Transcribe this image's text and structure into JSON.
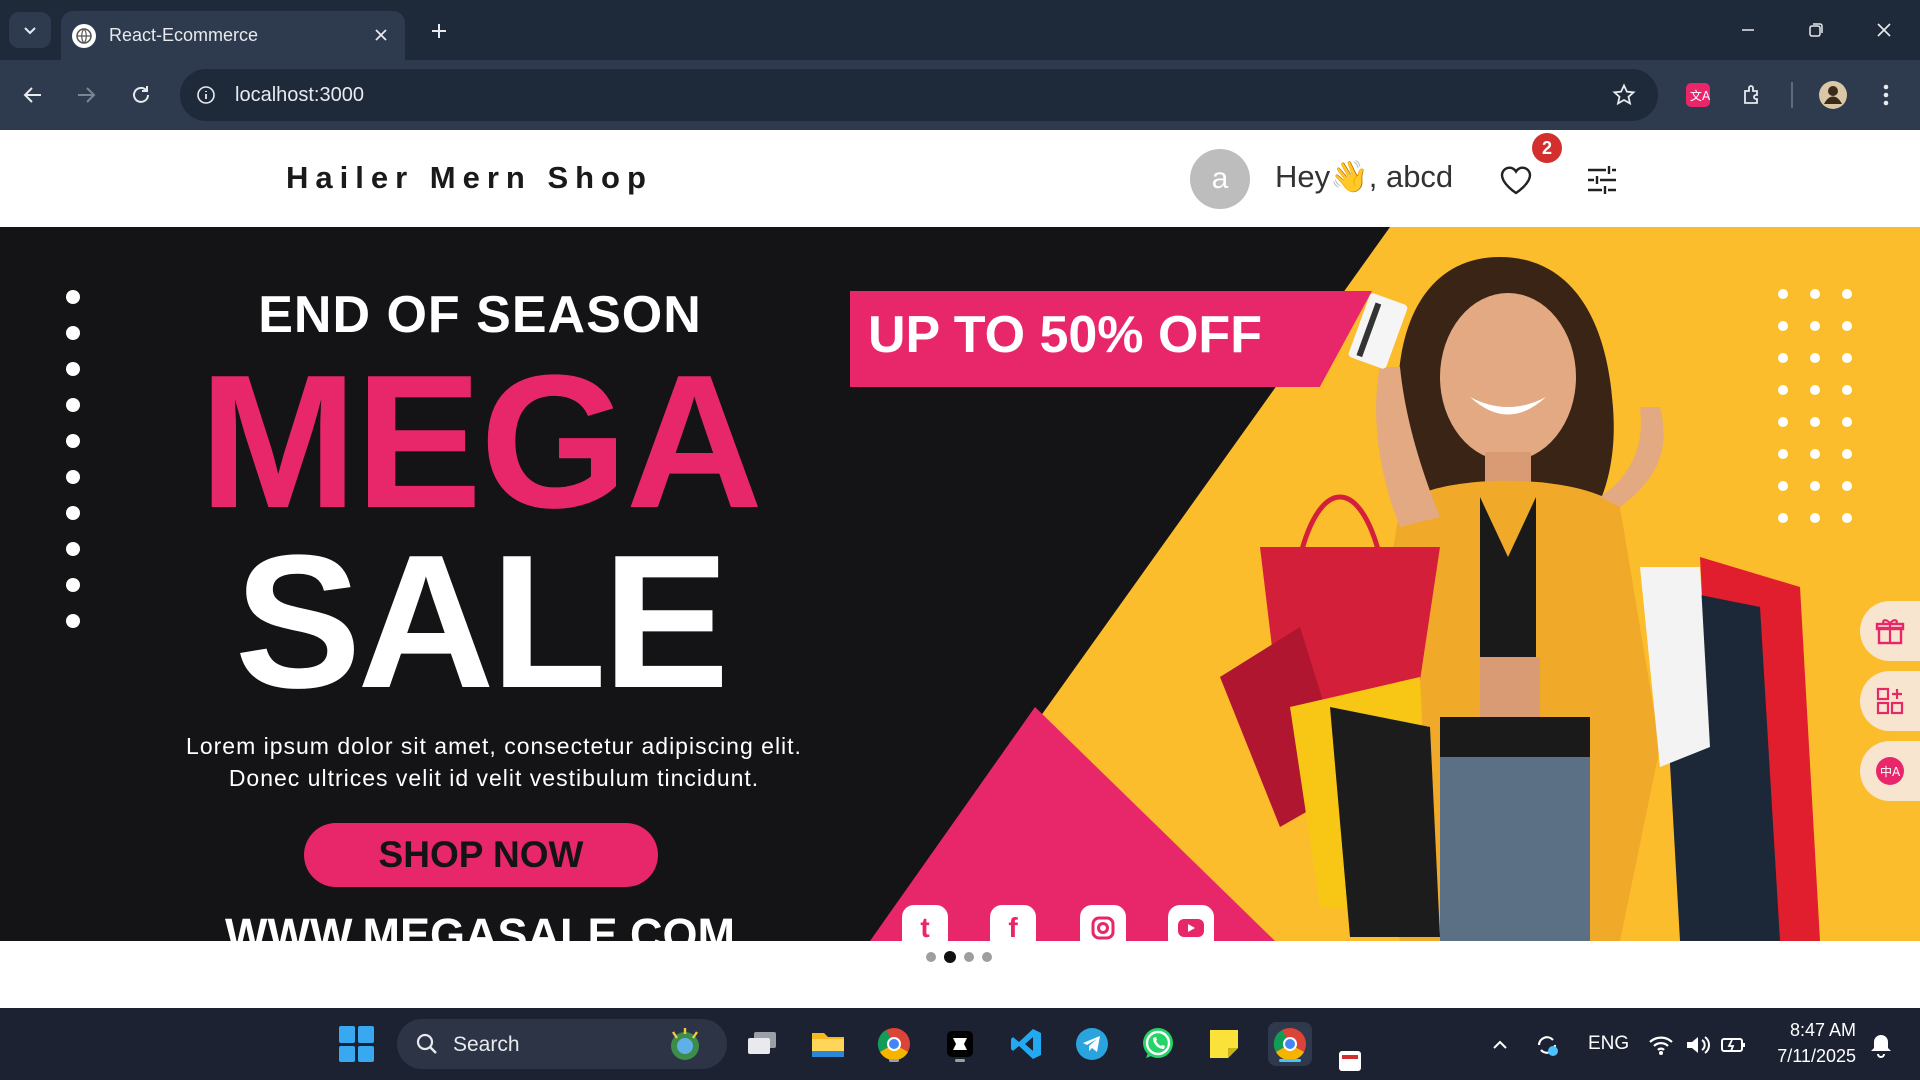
{
  "browser": {
    "tab_title": "React-Ecommerce",
    "url": "localhost:3000"
  },
  "header": {
    "brand": "Hailer Mern Shop",
    "avatar_letter": "a",
    "greeting": "Hey👋, abcd",
    "wishlist_count": "2"
  },
  "hero": {
    "eyebrow": "END OF SEASON",
    "headline_top": "MEGA",
    "headline_bottom": "SALE",
    "description_line1": "Lorem ipsum dolor sit amet, consectetur adipiscing elit.",
    "description_line2": "Donec ultrices velit id velit vestibulum tincidunt.",
    "cta": "SHOP NOW",
    "website": "WWW.MEGASALE.COM",
    "offer": "UP TO 50% OFF",
    "social": [
      "twitter-icon",
      "facebook-icon",
      "instagram-icon",
      "youtube-icon"
    ],
    "colors": {
      "accent": "#e8276b",
      "yellow": "#fbbd2c",
      "dark": "#141315"
    }
  },
  "carousel": {
    "slides": 4,
    "active_index": 1
  },
  "taskbar": {
    "search_label": "Search",
    "language": "ENG",
    "time": "8:47 AM",
    "date": "7/11/2025",
    "apps": [
      "task-view",
      "file-explorer",
      "chrome",
      "app-black",
      "vscode",
      "telegram",
      "whatsapp",
      "sticky-notes",
      "chrome-active"
    ]
  }
}
